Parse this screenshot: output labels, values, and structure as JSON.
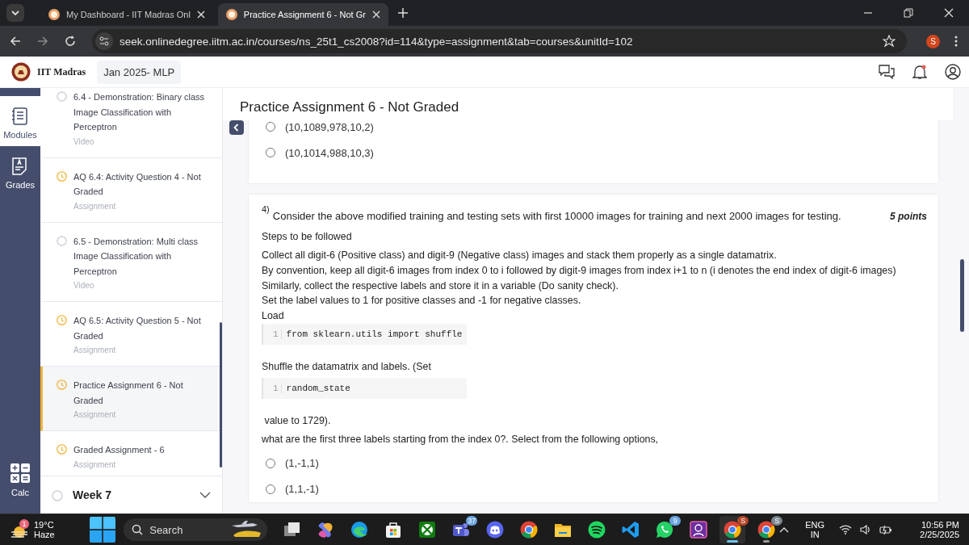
{
  "browser": {
    "tabs": [
      {
        "title": "My Dashboard - IIT Madras Onl",
        "selected": false
      },
      {
        "title": "Practice Assignment 6 - Not Gr",
        "selected": true
      }
    ],
    "url": "seek.onlinedegree.iitm.ac.in/courses/ns_25t1_cs2008?id=114&type=assignment&tab=courses&unitId=102",
    "profile": "S"
  },
  "header": {
    "brand": "IIT Madras",
    "course": "Jan 2025- MLP"
  },
  "rail": {
    "items": [
      {
        "kind": "modules",
        "label": "Modules",
        "selected": true
      },
      {
        "kind": "grades",
        "label": "Grades",
        "selected": false
      }
    ],
    "calc": "Calc"
  },
  "sidebar": {
    "items": [
      {
        "kind": "video",
        "title": "6.4 - Demonstration: Binary class Image Classification with Perceptron",
        "type": "Video",
        "selected": false
      },
      {
        "kind": "assignment",
        "title": "AQ 6.4: Activity Question 4 - Not Graded",
        "type": "Assignment",
        "selected": false
      },
      {
        "kind": "video",
        "title": "6.5 - Demonstration: Multi class Image Classification with Perceptron",
        "type": "Video",
        "selected": false
      },
      {
        "kind": "assignment",
        "title": "AQ 6.5: Activity Question 5 - Not Graded",
        "type": "Assignment",
        "selected": false
      },
      {
        "kind": "assignment",
        "title": "Practice Assignment 6 - Not Graded",
        "type": "Assignment",
        "selected": true
      },
      {
        "kind": "assignment",
        "title": "Graded Assignment - 6",
        "type": "Assignment",
        "selected": false
      }
    ],
    "week": {
      "title": "Week 7",
      "expanded": false
    }
  },
  "main": {
    "title": "Practice Assignment 6 - Not Graded",
    "previous_options": [
      {
        "label": "(10,1089,978,10,2)",
        "selected": false
      },
      {
        "label": "(10,1014,988,10,3)",
        "selected": false
      }
    ],
    "question": {
      "number": "4)",
      "text": "Consider the above modified training and testing sets with first 10000 images for training and next 2000 images for testing.",
      "points": "5 points",
      "blocks": [
        {
          "kind": "text",
          "text": "Steps to be followed"
        },
        {
          "kind": "paragraph",
          "lines": [
            "Collect all digit-6 (Positive class) and digit-9 (Negative class) images and stack them properly as a single datamatrix.",
            "By convention, keep all digit-6 images from index 0 to i followed by digit-9 images from index i+1 to n (i denotes the end index of digit-6 images)",
            "Similarly, collect the respective labels and store it in a variable (Do sanity check).",
            "Set the label values to 1 for positive classes and -1 for negative classes.",
            "Load"
          ]
        },
        {
          "kind": "code",
          "line": "1",
          "code": "from sklearn.utils import shuffle"
        },
        {
          "kind": "text",
          "text": "Shuffle the datamatrix and labels. (Set"
        },
        {
          "kind": "code",
          "line": "1",
          "code": "random_state"
        },
        {
          "kind": "text",
          "text": " value to 1729)."
        },
        {
          "kind": "text",
          "text": "what are the first three labels starting from the index 0?. Select from the following options,"
        }
      ],
      "options": [
        {
          "label": "(1,-1,1)",
          "selected": false
        },
        {
          "label": "(1,1,-1)",
          "selected": false
        }
      ]
    }
  },
  "taskbar": {
    "weather": {
      "temp": "19°C",
      "condition": "Haze",
      "badge": "1"
    },
    "search": "Search",
    "apps": [
      {
        "kind": "taskview"
      },
      {
        "kind": "copilot"
      },
      {
        "kind": "edge"
      },
      {
        "kind": "store"
      },
      {
        "kind": "xbox"
      },
      {
        "kind": "teams",
        "badge": "37"
      },
      {
        "kind": "discord"
      },
      {
        "kind": "chrome"
      },
      {
        "kind": "files"
      },
      {
        "kind": "spotify"
      },
      {
        "kind": "vscode"
      },
      {
        "kind": "whatsapp",
        "badge": "9"
      },
      {
        "kind": "photo"
      },
      {
        "kind": "chrome",
        "badge": "S",
        "active": true
      },
      {
        "kind": "chrome",
        "badge": "S",
        "running": true
      }
    ],
    "language": "ENG",
    "region": "IN",
    "time": "10:56 PM",
    "date": "2/25/2025"
  }
}
